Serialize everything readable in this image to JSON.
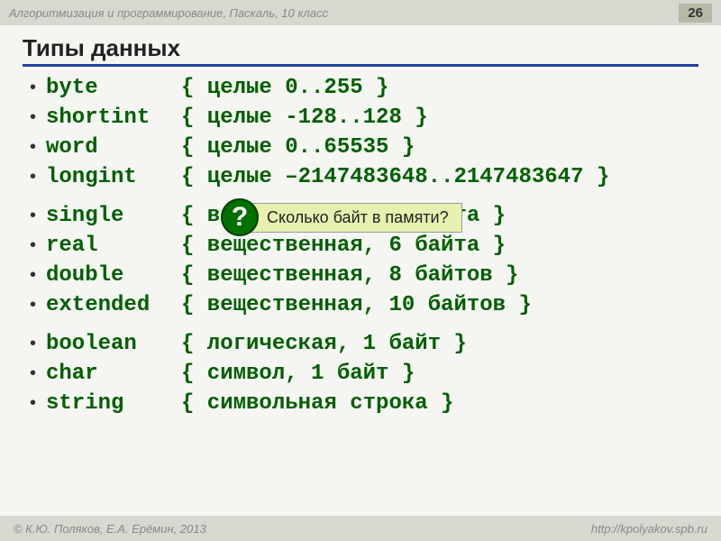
{
  "header": {
    "course": "Алгоритмизация и программирование, Паскаль, 10 класс",
    "page": "26"
  },
  "title": "Типы данных",
  "groups": [
    [
      {
        "name": "byte",
        "comment": "{ целые 0..255 }"
      },
      {
        "name": "shortint",
        "comment": "{ целые -128..128 }"
      },
      {
        "name": "word",
        "comment": "{ целые 0..65535 }"
      },
      {
        "name": "longint",
        "comment": "{ целые –2147483648..2147483647 }"
      }
    ],
    [
      {
        "name": "single",
        "comment": "{ вещественная, 4 байта }",
        "question": true
      },
      {
        "name": "real",
        "comment": "{ вещественная, 6 байта }"
      },
      {
        "name": "double",
        "comment": "{ вещественная, 8 байтов }"
      },
      {
        "name": "extended",
        "comment": "{ вещественная, 10 байтов }"
      }
    ],
    [
      {
        "name": "boolean",
        "comment": "{ логическая, 1 байт }"
      },
      {
        "name": "char",
        "comment": "{ символ, 1 байт }"
      },
      {
        "name": "string",
        "comment": "{ символьная строка }"
      }
    ]
  ],
  "question": {
    "mark": "?",
    "text": "Сколько байт в памяти?"
  },
  "footer": {
    "left": "© К.Ю. Поляков, Е.А. Ерёмин, 2013",
    "right": "http://kpolyakov.spb.ru"
  }
}
